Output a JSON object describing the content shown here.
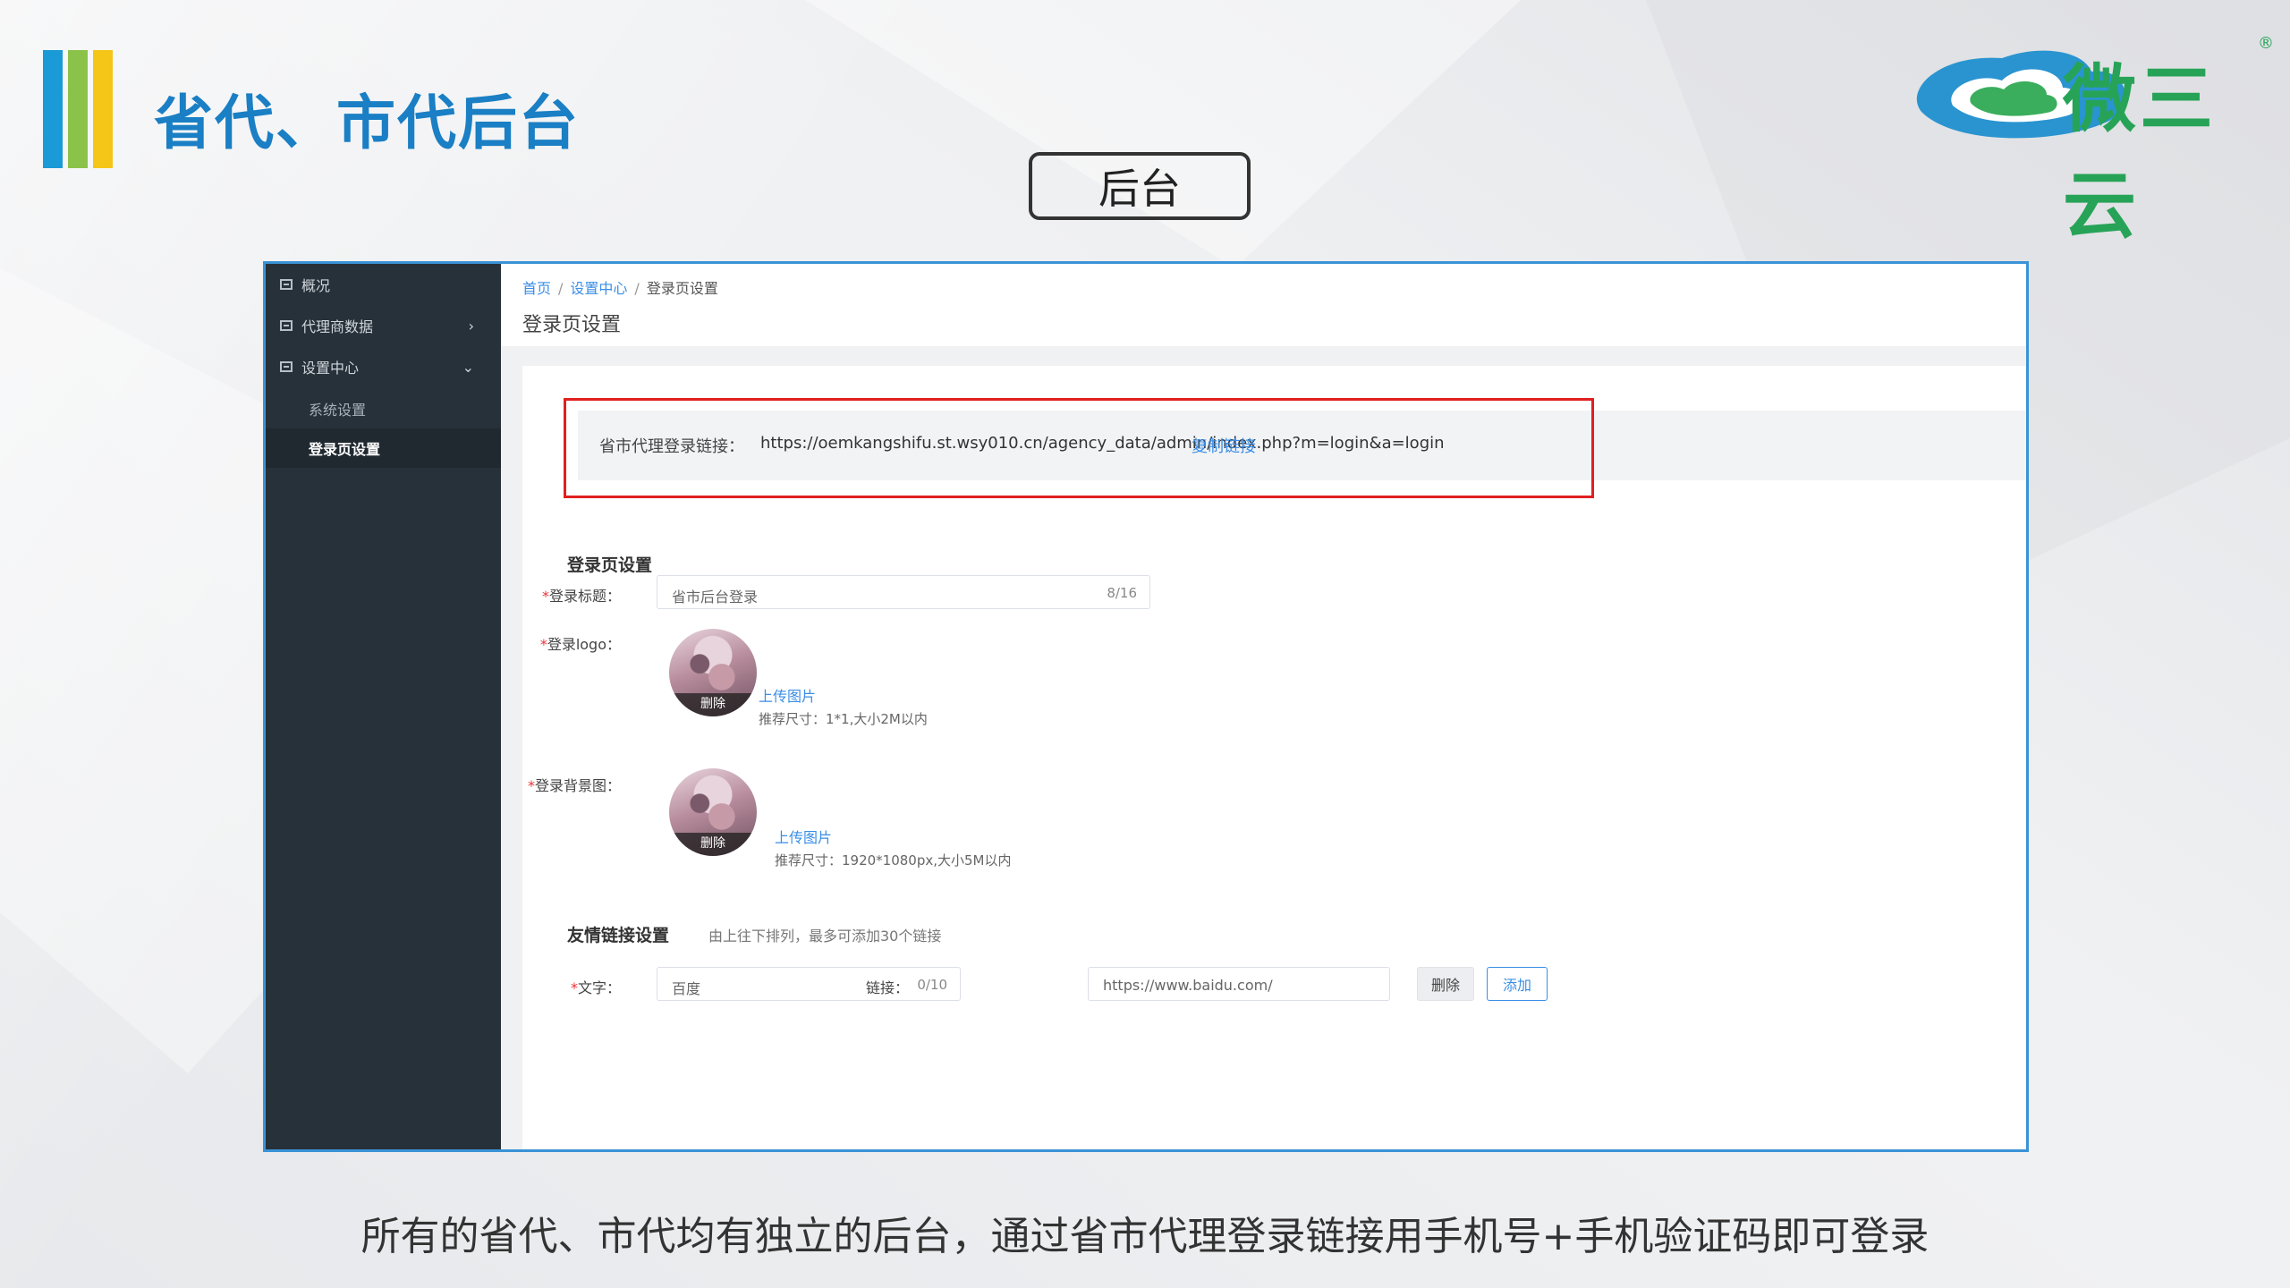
{
  "slide": {
    "title": "省代、市代后台",
    "section_label": "后台",
    "caption": "所有的省代、市代均有独立的后台，通过省市代理登录链接用手机号+手机验证码即可登录",
    "brand_text": "微三云",
    "brand_reg": "®",
    "colors": {
      "title": "#1a7fc4",
      "brand": "#27a357",
      "frame_border": "#3a93d6",
      "highlight": "#e02020"
    }
  },
  "sidebar": {
    "items": [
      {
        "label": "概况",
        "icon": "grid-icon"
      },
      {
        "label": "代理商数据",
        "icon": "grid-icon",
        "chevron": "›"
      },
      {
        "label": "设置中心",
        "icon": "grid-icon",
        "chevron": "⌄"
      }
    ],
    "sub_items": [
      {
        "label": "系统设置"
      },
      {
        "label": "登录页设置",
        "active": true
      }
    ]
  },
  "breadcrumb": {
    "home": "首页",
    "settings": "设置中心",
    "current": "登录页设置",
    "sep": "/"
  },
  "page_heading": "登录页设置",
  "login_link": {
    "label": "省市代理登录链接：",
    "url": "https://oemkangshifu.st.wsy010.cn/agency_data/admin/index.php?m=login&a=login",
    "copy_label": "复制链接"
  },
  "login_settings": {
    "section_title": "登录页设置",
    "title_field": {
      "label": "登录标题：",
      "value": "省市后台登录",
      "count": "8/16"
    },
    "logo_field": {
      "label": "登录logo：",
      "delete_label": "删除",
      "upload_label": "上传图片",
      "hint": "推荐尺寸：1*1,大小2M以内"
    },
    "bg_field": {
      "label": "登录背景图：",
      "delete_label": "删除",
      "upload_label": "上传图片",
      "hint": "推荐尺寸：1920*1080px,大小5M以内"
    },
    "required_mark": "*"
  },
  "friend_links": {
    "section_title": "友情链接设置",
    "note": "由上往下排列，最多可添加30个链接",
    "text_label": "文字：",
    "text_value": "百度",
    "text_count": "0/10",
    "link_label": "链接：",
    "link_value": "https://www.baidu.com/",
    "delete_label": "删除",
    "add_label": "添加"
  }
}
